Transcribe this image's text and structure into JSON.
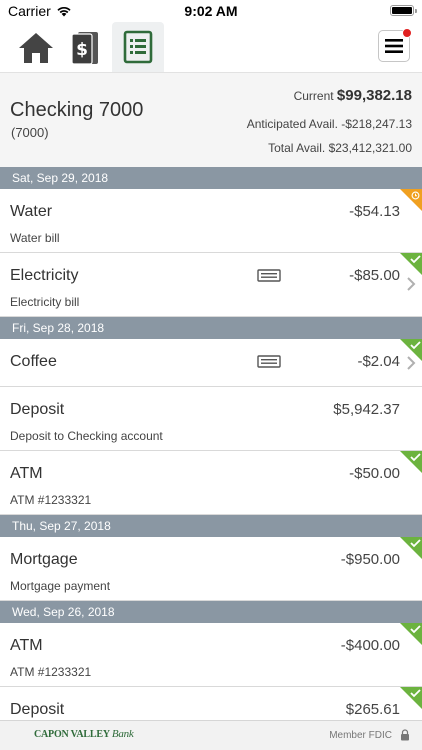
{
  "status_bar": {
    "carrier": "Carrier",
    "time": "9:02 AM"
  },
  "nav": {
    "tabs": [
      {
        "icon": "home-icon"
      },
      {
        "icon": "money-stack-icon"
      },
      {
        "icon": "ledger-list-icon",
        "active": true
      }
    ],
    "menu_icon": "hamburger-menu-icon",
    "notification_color": "#e02020"
  },
  "account": {
    "name": "Checking 7000",
    "number": "(7000)",
    "current_label": "Current",
    "current_value": "$99,382.18",
    "anticipated_label": "Anticipated Avail.",
    "anticipated_value": "-$218,247.13",
    "total_label": "Total Avail.",
    "total_value": "$23,412,321.00"
  },
  "colors": {
    "accent_green": "#2f6b3a",
    "cleared_green": "#6cb33f",
    "pending_orange": "#f0a020",
    "date_header_bg": "#8a97a3"
  },
  "groups": [
    {
      "date": "Sat, Sep 29, 2018",
      "transactions": [
        {
          "title": "Water",
          "description": "Water bill",
          "amount": "-$54.13",
          "status": "pending"
        },
        {
          "title": "Electricity",
          "description": "Electricity bill",
          "amount": "-$85.00",
          "status": "cleared",
          "has_attachment": true,
          "has_chevron": true
        }
      ]
    },
    {
      "date": "Fri, Sep 28, 2018",
      "transactions": [
        {
          "title": "Coffee",
          "description": "",
          "amount": "-$2.04",
          "status": "cleared",
          "has_attachment": true,
          "has_chevron": true
        },
        {
          "title": "Deposit",
          "description": "Deposit to Checking account",
          "amount": "$5,942.37",
          "status": "none"
        },
        {
          "title": "ATM",
          "description": "ATM #1233321",
          "amount": "-$50.00",
          "status": "cleared"
        }
      ]
    },
    {
      "date": "Thu, Sep 27, 2018",
      "transactions": [
        {
          "title": "Mortgage",
          "description": "Mortgage payment",
          "amount": "-$950.00",
          "status": "cleared"
        }
      ]
    },
    {
      "date": "Wed, Sep 26, 2018",
      "transactions": [
        {
          "title": "ATM",
          "description": "ATM #1233321",
          "amount": "-$400.00",
          "status": "cleared"
        },
        {
          "title": "Deposit",
          "description": "",
          "amount": "$265.61",
          "status": "cleared"
        }
      ]
    }
  ],
  "footer": {
    "bank_name": "CAPON VALLEY",
    "bank_script": "Bank",
    "member_text": "Member FDIC"
  }
}
